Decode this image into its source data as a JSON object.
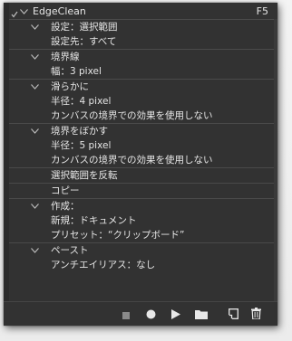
{
  "action_set": {
    "title": "EdgeClean",
    "shortcut": "F5"
  },
  "steps": [
    {
      "label": "設定：選択範囲",
      "details": [
        "設定先：すべて"
      ]
    },
    {
      "label": "境界線",
      "details": [
        "幅：3 pixel"
      ]
    },
    {
      "label": "滑らかに",
      "details": [
        "半径：4 pixel",
        "カンバスの境界での効果を使用しない"
      ]
    },
    {
      "label": "境界をぼかす",
      "details": [
        "半径：5 pixel",
        "カンバスの境界での効果を使用しない"
      ]
    },
    {
      "label": "選択範囲を反転",
      "details": []
    },
    {
      "label": "コピー",
      "details": []
    },
    {
      "label": "作成：",
      "details": [
        "新規：ドキュメント",
        "プリセット：“クリップボード”"
      ]
    },
    {
      "label": "ペースト",
      "details": [
        "アンチエイリアス：なし"
      ]
    }
  ],
  "toolbar": {
    "stop": "stop-icon",
    "record": "record-icon",
    "play": "play-icon",
    "new_set": "folder-icon",
    "new_action": "new-item-icon",
    "delete": "trash-icon"
  },
  "colors": {
    "panel_bg": "#323232",
    "text": "#e6e6e6",
    "divider": "#4a4a4a"
  }
}
